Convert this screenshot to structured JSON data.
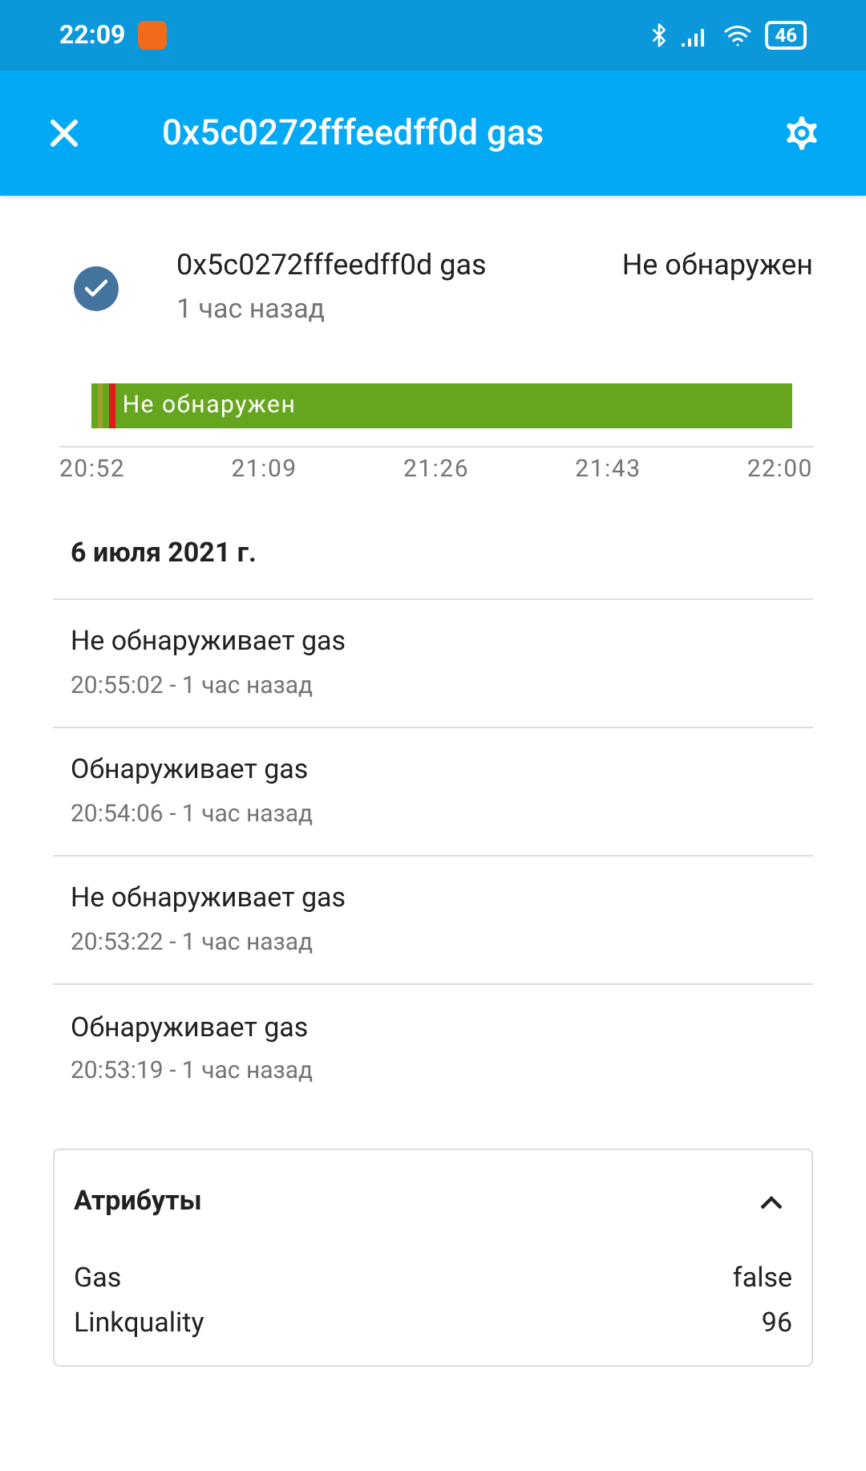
{
  "status_bar": {
    "time": "22:09",
    "battery": "46"
  },
  "app_bar": {
    "title": "0x5c0272fffeedff0d gas"
  },
  "entity": {
    "name": "0x5c0272fffeedff0d gas",
    "state": "Не обнаружен",
    "time": "1 час назад",
    "checked": true
  },
  "timeline": {
    "segments": [
      {
        "color": "#66a61e"
      },
      {
        "color": "#a0a030"
      },
      {
        "color": "#66a61e"
      },
      {
        "color": "#e31a1c"
      },
      {
        "color": "#66a61e",
        "label": "Не обнаружен"
      }
    ],
    "ticks": [
      "20:52",
      "21:09",
      "21:26",
      "21:43",
      "22:00"
    ]
  },
  "history": {
    "date": "6 июля 2021 г.",
    "events": [
      {
        "message": "Не обнаруживает gas",
        "time": "20:55:02 - 1 час назад"
      },
      {
        "message": "Обнаруживает gas",
        "time": "20:54:06 - 1 час назад"
      },
      {
        "message": "Не обнаруживает gas",
        "time": "20:53:22 - 1 час назад"
      },
      {
        "message": "Обнаруживает gas",
        "time": "20:53:19 - 1 час назад"
      }
    ]
  },
  "attributes": {
    "title": "Атрибуты",
    "expanded": true,
    "rows": [
      {
        "name": "Gas",
        "value": "false"
      },
      {
        "name": "Linkquality",
        "value": "96"
      }
    ]
  }
}
